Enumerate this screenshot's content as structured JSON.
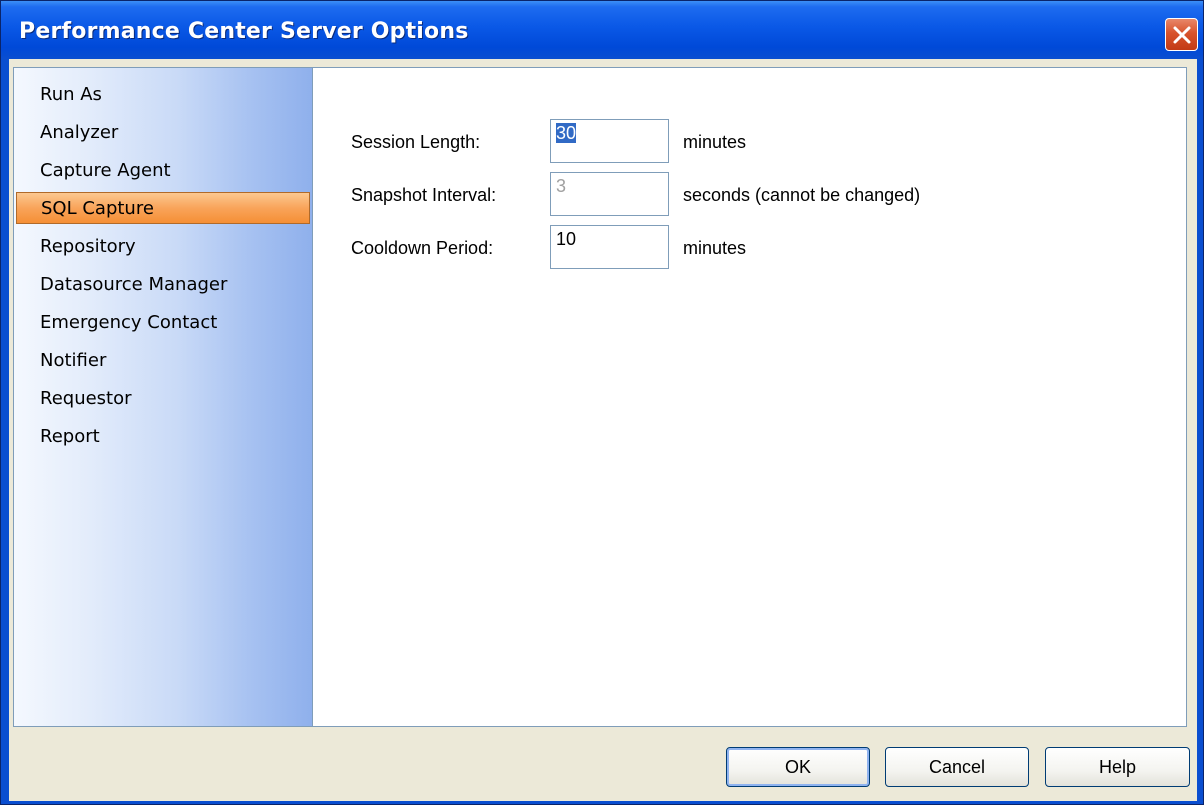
{
  "window": {
    "title": "Performance Center Server Options"
  },
  "sidebar": {
    "items": [
      {
        "label": "Run As"
      },
      {
        "label": "Analyzer"
      },
      {
        "label": "Capture Agent"
      },
      {
        "label": "SQL Capture",
        "selected": true
      },
      {
        "label": "Repository"
      },
      {
        "label": "Datasource Manager"
      },
      {
        "label": "Emergency Contact"
      },
      {
        "label": "Notifier"
      },
      {
        "label": "Requestor"
      },
      {
        "label": "Report"
      }
    ]
  },
  "sql_capture": {
    "session_length": {
      "label": "Session Length:",
      "value": "30",
      "unit": "minutes"
    },
    "snapshot_interval": {
      "label": "Snapshot Interval:",
      "value": "3",
      "unit": "seconds  (cannot be changed)"
    },
    "cooldown_period": {
      "label": "Cooldown Period:",
      "value": "10",
      "unit": "minutes"
    }
  },
  "buttons": {
    "ok": "OK",
    "cancel": "Cancel",
    "help": "Help"
  },
  "colors": {
    "titlebar": "#0049d8",
    "selected_item": "#f9a45a",
    "close_button": "#d8532c"
  }
}
